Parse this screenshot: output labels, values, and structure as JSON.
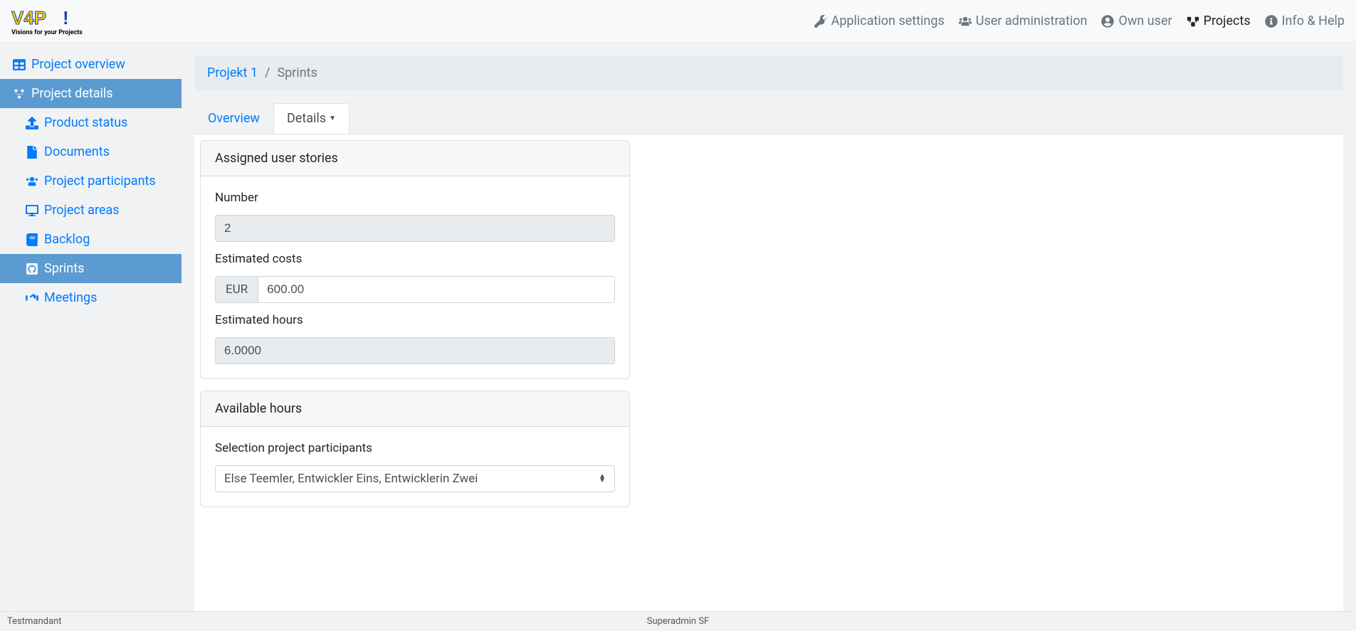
{
  "logo_tagline": "Visions for your Projects",
  "nav": {
    "app_settings": "Application settings",
    "user_admin": "User administration",
    "own_user": "Own user",
    "projects": "Projects",
    "info_help": "Info & Help"
  },
  "sidebar": {
    "project_overview": "Project overview",
    "project_details": "Project details",
    "product_status": "Product status",
    "documents": "Documents",
    "project_participants": "Project participants",
    "project_areas": "Project areas",
    "backlog": "Backlog",
    "sprints": "Sprints",
    "meetings": "Meetings"
  },
  "breadcrumb": {
    "project": "Projekt 1",
    "current": "Sprints"
  },
  "tabs": {
    "overview": "Overview",
    "details": "Details"
  },
  "card1": {
    "title": "Assigned user stories",
    "number_label": "Number",
    "number_value": "2",
    "est_costs_label": "Estimated costs",
    "currency": "EUR",
    "est_costs_value": "600.00",
    "est_hours_label": "Estimated hours",
    "est_hours_value": "6.0000"
  },
  "card2": {
    "title": "Available hours",
    "selection_label": "Selection project participants",
    "selection_value": "Else Teemler, Entwickler Eins, Entwicklerin Zwei"
  },
  "footer": {
    "left": "Testmandant",
    "center": "Superadmin SF"
  }
}
